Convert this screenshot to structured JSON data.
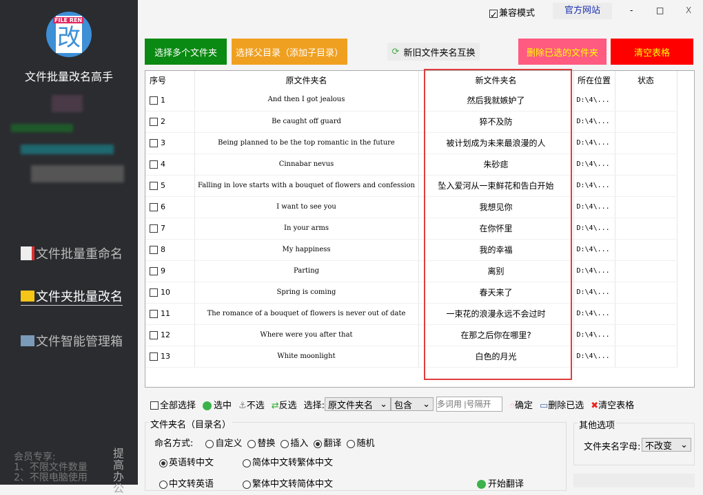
{
  "sidebar": {
    "app_title": "文件批量改名高手",
    "nav": [
      {
        "label": "文件批量重命名",
        "icon": "document-icon"
      },
      {
        "label": "文件夹批量改名",
        "icon": "folder-icon"
      },
      {
        "label": "文件智能管理箱",
        "icon": "search-box-icon"
      }
    ],
    "vip_lines": [
      "会员专享:",
      "1、不限文件数量",
      "2、不限电脑使用"
    ],
    "vip_side": "提高办公"
  },
  "titlebar": {
    "compat_mode": "兼容模式",
    "official_site": "官方网站",
    "minimize": "-",
    "maximize": "□",
    "close": "X"
  },
  "actions": {
    "select_folders": "选择多个文件夹",
    "select_parent": "选择父目录（添加子目录）",
    "swap": "新旧文件夹名互换",
    "delete_selected": "删除已选的文件夹",
    "clear_table": "清空表格"
  },
  "colors": {
    "green": "#0a8a12",
    "orange": "#f0a020",
    "pink": "#ff5a80",
    "red": "#ff0000",
    "highlight": "#e03c3c"
  },
  "table": {
    "headers": [
      "序号",
      "原文件夹名",
      "新文件夹名",
      "所在位置",
      "状态"
    ],
    "rows": [
      {
        "no": "1",
        "orig": "And then I got jealous",
        "new": "然后我就嫉妒了",
        "loc": "D:\\4\\..."
      },
      {
        "no": "2",
        "orig": "Be caught off guard",
        "new": "猝不及防",
        "loc": "D:\\4\\..."
      },
      {
        "no": "3",
        "orig": "Being planned to be the top romantic in the future",
        "new": "被计划成为未来最浪漫的人",
        "loc": "D:\\4\\..."
      },
      {
        "no": "4",
        "orig": "Cinnabar nevus",
        "new": "朱砂痣",
        "loc": "D:\\4\\..."
      },
      {
        "no": "5",
        "orig": "Falling in love starts with a bouquet of flowers and confession",
        "new": "坠入爱河从一束鲜花和告白开始",
        "loc": "D:\\4\\..."
      },
      {
        "no": "6",
        "orig": "I want to see you",
        "new": "我想见你",
        "loc": "D:\\4\\..."
      },
      {
        "no": "7",
        "orig": "In your arms",
        "new": "在你怀里",
        "loc": "D:\\4\\..."
      },
      {
        "no": "8",
        "orig": "My happiness",
        "new": "我的幸福",
        "loc": "D:\\4\\..."
      },
      {
        "no": "9",
        "orig": "Parting",
        "new": "离别",
        "loc": "D:\\4\\..."
      },
      {
        "no": "10",
        "orig": "Spring is coming",
        "new": "春天来了",
        "loc": "D:\\4\\..."
      },
      {
        "no": "11",
        "orig": "The romance of a bouquet of flowers is never out of date",
        "new": "一束花的浪漫永远不会过时",
        "loc": "D:\\4\\..."
      },
      {
        "no": "12",
        "orig": "Where were you after that",
        "new": "在那之后你在哪里?",
        "loc": "D:\\4\\..."
      },
      {
        "no": "13",
        "orig": "White moonlight",
        "new": "白色的月光",
        "loc": "D:\\4\\..."
      }
    ]
  },
  "toolbar": {
    "select_all": "全部选择",
    "check": "选中",
    "uncheck": "不选",
    "invert": "反选",
    "select_label": "选择:",
    "field": "原文件夹名",
    "match": "包含",
    "keyword_placeholder": "多词用 |号隔开",
    "confirm": "确定",
    "delete_selected": "删除已选",
    "clear_table": "清空表格"
  },
  "options": {
    "group_title": "文件夹名（目录名）",
    "naming_label": "命名方式:",
    "modes": [
      "自定义",
      "替换",
      "插入",
      "翻译",
      "随机"
    ],
    "selected_mode": "翻译",
    "translate": [
      "英语转中文",
      "简体中文转繁体中文",
      "中文转英语",
      "繁体中文转简体中文"
    ],
    "selected_translate": "英语转中文",
    "start": "开始翻译"
  },
  "other": {
    "title": "其他选项",
    "case_label": "文件夹名字母:",
    "case_value": "不改变"
  }
}
